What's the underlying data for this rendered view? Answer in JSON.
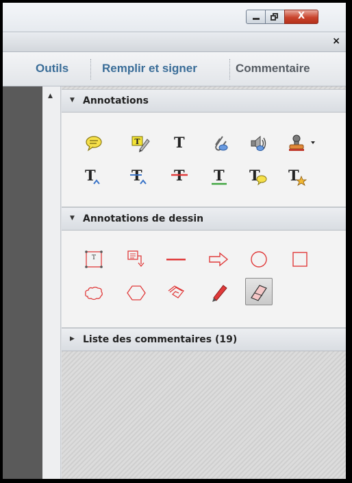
{
  "window": {
    "close_glyph": "X"
  },
  "panel_close_glyph": "×",
  "tabs": [
    "Outils",
    "Remplir et signer",
    "Commentaire"
  ],
  "scroll_up_glyph": "▲",
  "sections": [
    {
      "title": "Annotations",
      "expanded": true,
      "arrow": "▼"
    },
    {
      "title": "Annotations de dessin",
      "expanded": true,
      "arrow": "▼"
    },
    {
      "title": "Liste des commentaires (19)",
      "expanded": false,
      "arrow": "▶"
    }
  ],
  "annotation_tools_row1": [
    "sticky-note-icon",
    "highlight-text-icon",
    "add-text-icon",
    "attach-file-icon",
    "record-audio-icon",
    "stamp-icon"
  ],
  "annotation_tools_row2": [
    "insert-text-icon",
    "replace-text-icon",
    "strikethrough-icon",
    "underline-icon",
    "text-comment-icon",
    "text-favorite-icon"
  ],
  "drawing_tools_row1": [
    "text-box-icon",
    "callout-icon",
    "line-icon",
    "arrow-icon",
    "oval-icon",
    "rectangle-icon"
  ],
  "drawing_tools_row2": [
    "cloud-icon",
    "polygon-icon",
    "connected-lines-icon",
    "pencil-icon",
    "eraser-icon"
  ],
  "selected_tool": "eraser-icon",
  "text_glyph": "T",
  "colors": {
    "accent_tab": "#3a6d98",
    "drawing_red": "#e03a3a",
    "highlight_yellow": "#f2e233",
    "underline_green": "#3fa53f",
    "insert_blue": "#3a74c8"
  }
}
